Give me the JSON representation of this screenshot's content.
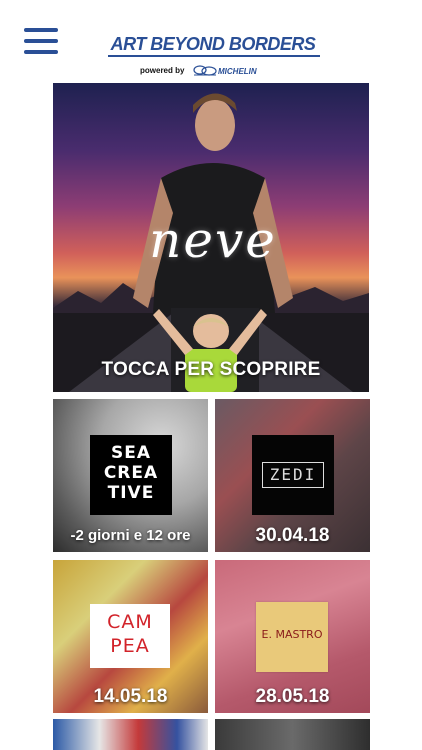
{
  "header": {
    "menu_icon": "hamburger-menu-icon",
    "logo_title": "ART BEYOND BORDERS",
    "powered_by": "powered by",
    "sponsor": "MICHELIN",
    "brand_color": "#2a4f96"
  },
  "hero": {
    "title": "neve",
    "cta": "TOCCA PER SCOPRIRE"
  },
  "tiles": [
    {
      "logo_lines": [
        "SEA",
        "CREA",
        "TIVE"
      ],
      "caption": "-2 giorni e 12 ore"
    },
    {
      "logo": "ZEDI",
      "caption": "30.04.18"
    },
    {
      "logo_lines": [
        "CAM",
        "PEA"
      ],
      "caption": "14.05.18"
    },
    {
      "logo": "E. MASTRO",
      "caption": "28.05.18"
    }
  ]
}
